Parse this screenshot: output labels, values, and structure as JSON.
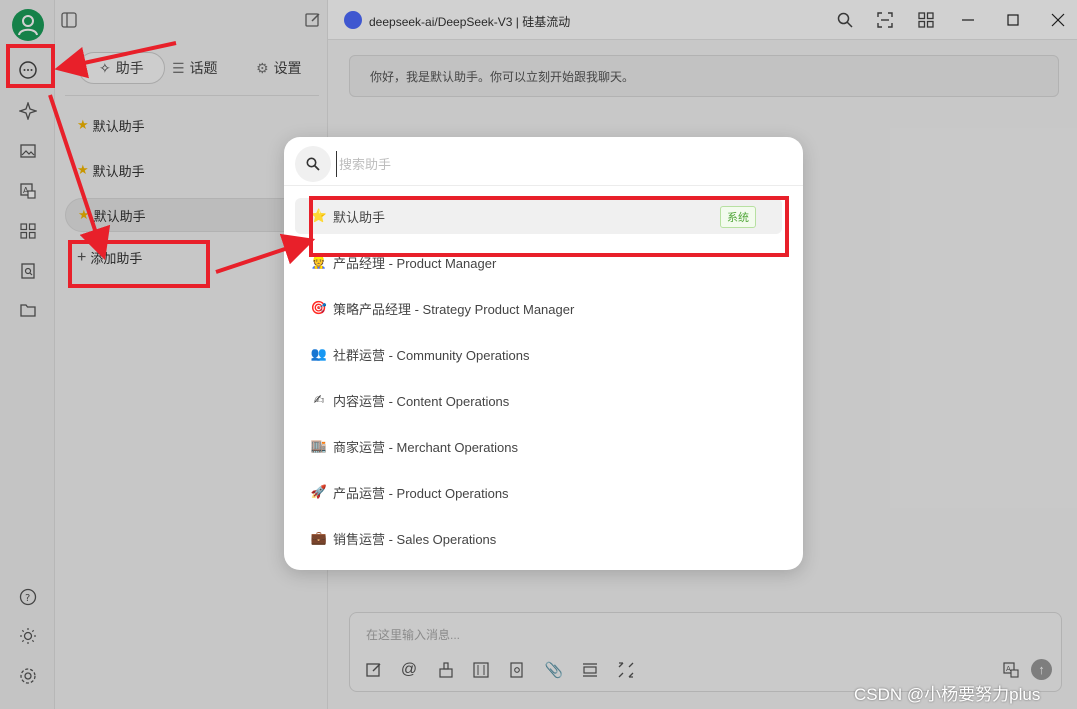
{
  "window": {
    "title": "deepseek-ai/DeepSeek-V3 | 硅基流动"
  },
  "assistant_panel": {
    "tabs": [
      {
        "label": "助手",
        "icon": "sparkle-icon"
      },
      {
        "label": "话题",
        "icon": "list-icon"
      },
      {
        "label": "设置",
        "icon": "gear-icon"
      }
    ],
    "items": [
      {
        "label": "默认助手",
        "icon": "star"
      },
      {
        "label": "默认助手",
        "icon": "star"
      },
      {
        "label": "默认助手",
        "icon": "star"
      }
    ],
    "add_label": "添加助手"
  },
  "chat": {
    "greeting": "你好，我是默认助手。你可以立刻开始跟我聊天。",
    "input_placeholder": "在这里输入消息..."
  },
  "popup": {
    "search_placeholder": "搜索助手",
    "items": [
      {
        "emoji": "⭐",
        "label": "默认助手",
        "badge": "系统"
      },
      {
        "emoji": "👷",
        "label": "产品经理 - Product Manager"
      },
      {
        "emoji": "🎯",
        "label": "策略产品经理 - Strategy Product Manager"
      },
      {
        "emoji": "👥",
        "label": "社群运营 - Community Operations"
      },
      {
        "emoji": "✍",
        "label": "内容运营 - Content Operations"
      },
      {
        "emoji": "🏬",
        "label": "商家运营 - Merchant Operations"
      },
      {
        "emoji": "🚀",
        "label": "产品运营 - Product Operations"
      },
      {
        "emoji": "💼",
        "label": "销售运营 - Sales Operations"
      }
    ]
  },
  "watermark": "CSDN @小杨要努力plus",
  "colors": {
    "annotation_red": "#e8202a",
    "avatar_green": "#1a9e5a",
    "badge_green": "#52a73a"
  }
}
